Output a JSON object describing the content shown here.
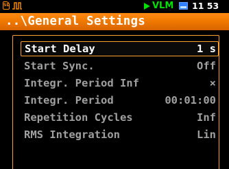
{
  "status_bar": {
    "sd_icon_text": "SD",
    "mode": "VLM",
    "time": "11 53",
    "icons": [
      "sd-card-icon",
      "pulse-icon",
      "play-icon",
      "battery-icon"
    ],
    "colors": {
      "mode": "#00e000",
      "sd_icon": "#ff8c00",
      "battery": "#2f7fff"
    }
  },
  "title": "..\\General Settings",
  "menu": {
    "items": [
      {
        "label": "Start Delay",
        "value": "1 s",
        "selected": true
      },
      {
        "label": "Start Sync.",
        "value": "Off",
        "selected": false
      },
      {
        "label": "Integr. Period Inf",
        "value": "×",
        "selected": false
      },
      {
        "label": "Integr. Period",
        "value": "00:01:00",
        "selected": false
      },
      {
        "label": "Repetition Cycles",
        "value": "Inf",
        "selected": false
      },
      {
        "label": "RMS Integration",
        "value": "Lin",
        "selected": false
      }
    ]
  },
  "colors": {
    "accent": "#f07a00",
    "background": "#000000",
    "text_inactive": "#a0a0a0",
    "text_selected": "#ffffff"
  }
}
